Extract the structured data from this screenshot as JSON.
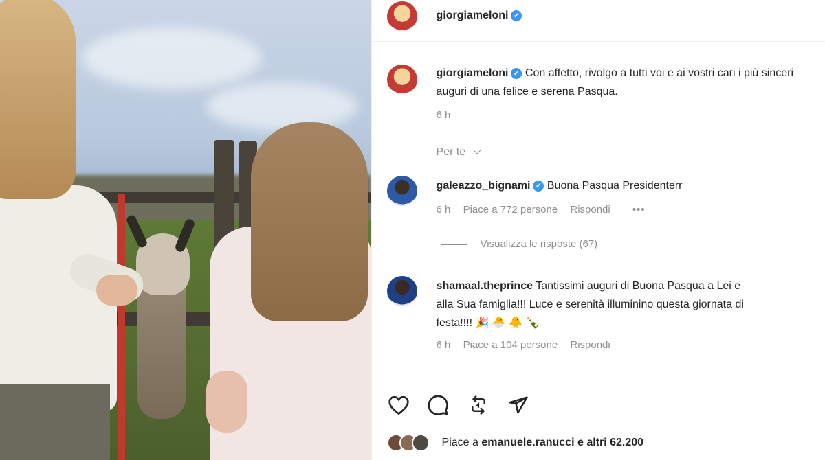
{
  "post": {
    "author": "giorgiameloni",
    "caption": "Con affetto, rivolgo a tutti voi e ai vostri cari i più sinceri auguri di una felice e serena Pasqua.",
    "time": "6 h",
    "sort_label": "Per te"
  },
  "comments": [
    {
      "user": "galeazzo_bignami",
      "verified": true,
      "text": "Buona Pasqua Presidenterr",
      "time": "6 h",
      "likes": "Piace a 772 persone",
      "reply": "Rispondi",
      "more": "•••",
      "view_replies": "Visualizza le risposte (67)"
    },
    {
      "user": "shamaal.theprince",
      "verified": false,
      "text_line1": "Tantissimi auguri di Buona Pasqua a Lei e",
      "text_line2": "alla Sua famiglia!!! Luce e serenità illuminino questa giornata di",
      "text_line3": "festa!!!! 🎉 🐣 🐥 🍾",
      "time": "6 h",
      "likes": "Piace a 104 persone",
      "reply": "Rispondi"
    }
  ],
  "actions": {
    "like_icon": "heart-icon",
    "comment_icon": "comment-icon",
    "repost_icon": "repost-icon",
    "share_icon": "share-icon"
  },
  "likes_summary": {
    "prefix": "Piace a",
    "user": "emanuele.ranucci",
    "suffix": "e altri 62.200"
  },
  "colors": {
    "verified": "#3897f0",
    "meta": "#8e8e8e",
    "text": "#262626"
  }
}
